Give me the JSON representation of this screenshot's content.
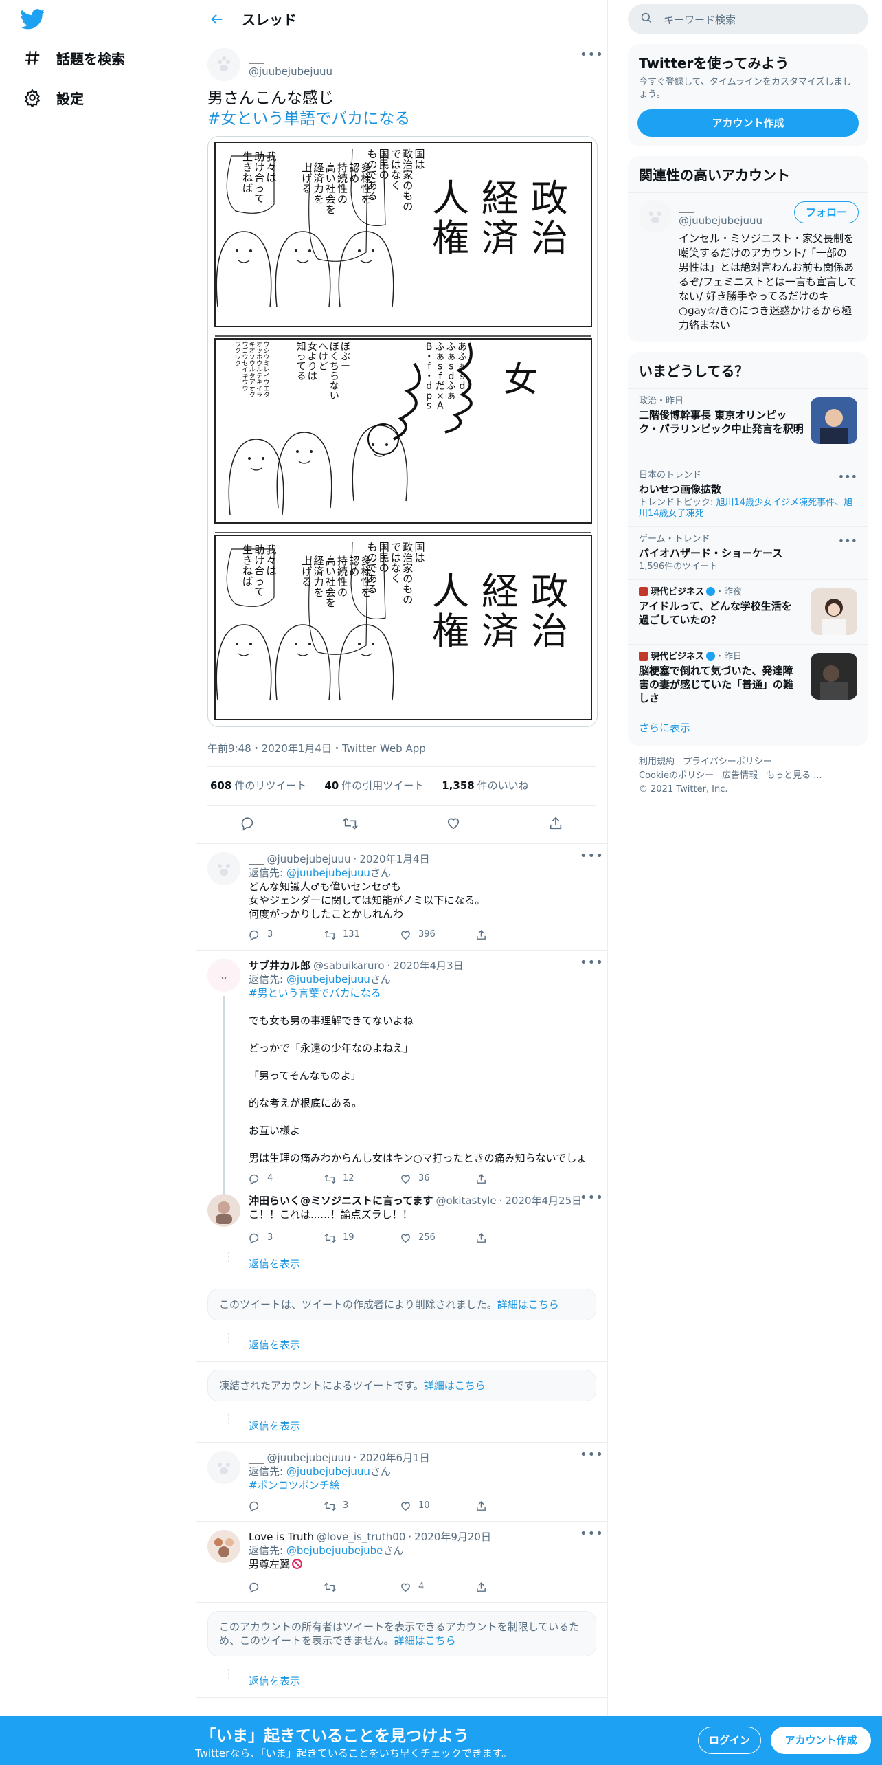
{
  "nav": {
    "explore": "話題を検索",
    "settings": "設定"
  },
  "header": {
    "title": "スレッド"
  },
  "main_tweet": {
    "display_name": "___",
    "handle": "@juubejubejuuu",
    "text_line1": "男さんこんな感じ",
    "hashtag": "#女という単語でバカになる",
    "meta": "午前9:48・2020年1月4日・Twitter Web App",
    "retweets_count": "608",
    "retweets_label": "件のリツイート",
    "quotes_count": "40",
    "quotes_label": "件の引用ツイート",
    "likes_count": "1,358",
    "likes_label": "件のいいね",
    "comic": {
      "panel1_title": [
        "政",
        "治",
        "経",
        "済",
        "人",
        "権"
      ],
      "panel1_bubble1": [
        "国は",
        "政治家のもの",
        "ではなく",
        "国民の",
        "ものである"
      ],
      "panel1_bubble2": [
        "多様性を",
        "認め",
        "持続性の",
        "高い社会を",
        "経済力を",
        "上げる"
      ],
      "panel1_bubble3": [
        "我々は",
        "助け合って",
        "生きねば"
      ],
      "panel2_title": "女",
      "panel2_text1": [
        "あふぁsd",
        "ふぁsdふぁ",
        "ふぁsfだ×A",
        "B・f・dps"
      ],
      "panel2_text2": [
        "ぼぶー",
        "ぼくちらない",
        "へけど",
        "女よりは",
        "知ってる"
      ],
      "panel2_text3": [
        "ウシウミレイウエタ",
        "オッホウルテキイラ",
        "キオソウルタアオク",
        "ウゴウセイキウウ",
        "ワクワク"
      ]
    }
  },
  "replies": [
    {
      "display_name": "___",
      "handle": "@juubejubejuuu",
      "date": "2020年1月4日",
      "reply_to_label": "返信先:",
      "reply_to": "@juubejubejuuu",
      "reply_to_suffix": "さん",
      "lines": [
        "どんな知識人♂も偉いセンセ♂も",
        "女やジェンダーに関しては知能がノミ以下になる。",
        "何度がっかりしたことかしれんわ"
      ],
      "replies": "3",
      "retweets": "131",
      "likes": "396"
    },
    {
      "display_name": "サブ井カル郎",
      "handle": "@sabuikaruro",
      "date": "2020年4月3日",
      "reply_to_label": "返信先:",
      "reply_to": "@juubejubejuuu",
      "reply_to_suffix": "さん",
      "hashtag": "#男という言葉でバカになる",
      "paras": [
        "でも女も男の事理解できてないよね",
        "どっかで「永遠の少年なのよねえ」",
        "「男ってそんなものよ」",
        "的な考えが根底にある。",
        "お互い様よ",
        "男は生理の痛みわからんし女はキン○マ打ったときの痛み知らないでしょ"
      ],
      "replies": "4",
      "retweets": "12",
      "likes": "36"
    },
    {
      "display_name": "沖田らいく@ミソジニストに言ってます",
      "handle": "@okitastyle",
      "date": "2020年4月25日",
      "text": "こ！！これは......！論点ズラし！！",
      "replies": "3",
      "retweets": "19",
      "likes": "256"
    },
    {
      "display_name": "___",
      "handle": "@juubejubejuuu",
      "date": "2020年6月1日",
      "reply_to_label": "返信先:",
      "reply_to": "@juubejubejuuu",
      "reply_to_suffix": "さん",
      "hashtag": "#ポンコツポンチ絵",
      "replies": "",
      "retweets": "3",
      "likes": "10"
    },
    {
      "display_name": "Love is Truth",
      "handle": "@love_is_truth00",
      "date": "2020年9月20日",
      "reply_to_label": "返信先:",
      "reply_to": "@bejubejuubejube",
      "reply_to_suffix": "さん",
      "text": "男尊左翼",
      "replies": "",
      "retweets": "",
      "likes": "4"
    }
  ],
  "show_replies": "返信を表示",
  "notices": {
    "deleted": "このツイートは、ツイートの作成者により削除されました。",
    "suspended": "凍結されたアカウントによるツイートです。",
    "restricted": "このアカウントの所有者はツイートを表示できるアカウントを制限しているため、このツイートを表示できません。",
    "learn_more": "詳細はこちら"
  },
  "right": {
    "search_placeholder": "キーワード検索",
    "signup_title": "Twitterを使ってみよう",
    "signup_desc": "今すぐ登録して、タイムラインをカスタマイズしましょう。",
    "signup_button": "アカウント作成",
    "related_title": "関連性の高いアカウント",
    "related_name": "___",
    "related_handle": "@juubejubejuuu",
    "follow": "フォロー",
    "related_bio": "インセル・ミソジニスト・家父長制を嘲笑するだけのアカウント/「一部の男性は」とは絶対言わんお前も関係あるぞ/フェミニストとは一言も宣言してない/ 好き勝手やってるだけのキ○gay☆/き○につき迷惑かけるから極力絡まない",
    "trends_title": "いまどうしてる？",
    "trends": [
      {
        "cat": "政治・昨日",
        "title": "二階俊博幹事長 東京オリンピック・パラリンピック中止発言を釈明"
      },
      {
        "cat": "日本のトレンド",
        "title": "わいせつ画像拡散",
        "sub_label": "トレンドトピック:",
        "sub": "旭川14歳少女イジメ凍死事件、旭川14歳女子凍死"
      },
      {
        "cat": "ゲーム・トレンド",
        "title": "バイオハザード・ショーケース",
        "sub": "1,596件のツイート"
      },
      {
        "cat_source": "現代ビジネス",
        "cat_time": "・昨夜",
        "title": "アイドルって、どんな学校生活を過ごしていたの？"
      },
      {
        "cat_source": "現代ビジネス",
        "cat_time": "・昨日",
        "title": "脳梗塞で倒れて気づいた、発達障害の妻が感じていた「普通」の難しさ"
      }
    ],
    "show_more": "さらに表示",
    "footer": [
      "利用規約",
      "プライバシーポリシー",
      "Cookieのポリシー",
      "広告情報",
      "もっと見る ...",
      "© 2021 Twitter, Inc."
    ]
  },
  "banner": {
    "title": "「いま」起きていることを見つけよう",
    "subtitle": "Twitterなら、「いま」起きていることをいち早くチェックできます。",
    "login": "ログイン",
    "signup": "アカウント作成"
  },
  "colors": {
    "accent": "#1da1f2",
    "link": "#1b95e0",
    "text": "#0f1419",
    "muted": "#5b7083"
  }
}
